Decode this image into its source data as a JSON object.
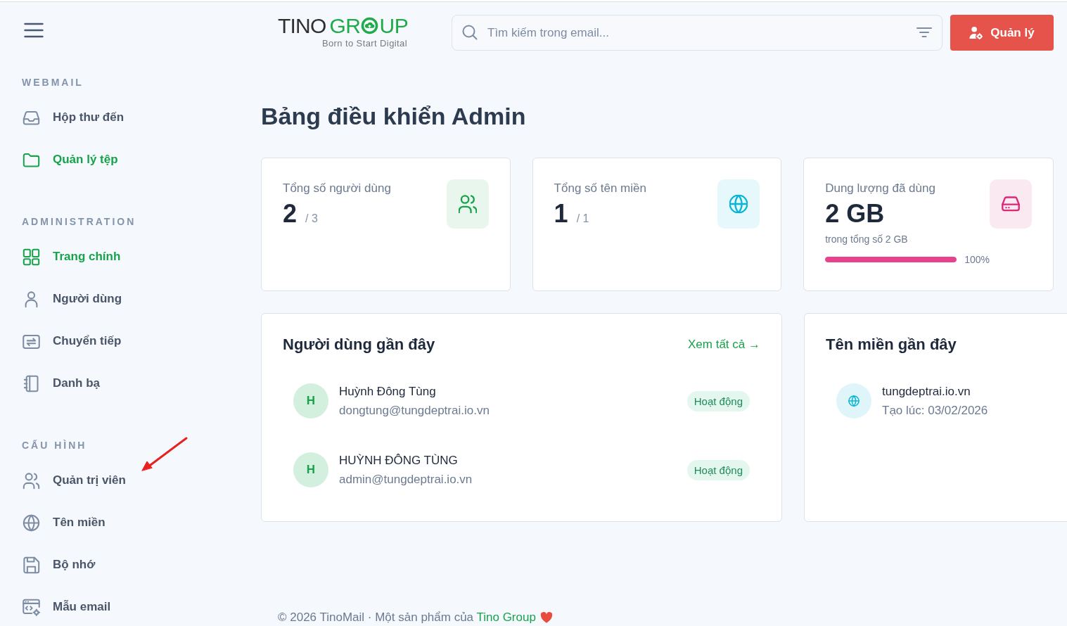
{
  "header": {
    "logo": {
      "word_parts": [
        "TINO",
        "GR",
        "UP"
      ],
      "tagline": "Born to Start Digital"
    },
    "search": {
      "placeholder": "Tìm kiếm trong email..."
    },
    "admin_button": "Quản lý"
  },
  "sidebar": {
    "sections": [
      {
        "title": "WEBMAIL",
        "items": [
          {
            "label": "Hộp thư đến",
            "selected": false
          },
          {
            "label": "Quản lý tệp",
            "selected": true
          }
        ]
      },
      {
        "title": "ADMINISTRATION",
        "items": [
          {
            "label": "Trang chính",
            "selected": true
          },
          {
            "label": "Người dùng",
            "selected": false
          },
          {
            "label": "Chuyển tiếp",
            "selected": false
          },
          {
            "label": "Danh bạ",
            "selected": false
          }
        ]
      },
      {
        "title": "CẤU HÌNH",
        "items": [
          {
            "label": "Quản trị viên",
            "selected": false
          },
          {
            "label": "Tên miền",
            "selected": false
          },
          {
            "label": "Bộ nhớ",
            "selected": false
          },
          {
            "label": "Mẫu email",
            "selected": false
          }
        ]
      }
    ]
  },
  "page_title": "Bảng điều khiển Admin",
  "stats": [
    {
      "kind": "users",
      "label": "Tổng số người dùng",
      "value": "2",
      "total": "/ 3",
      "color": "#16a34a"
    },
    {
      "kind": "domains",
      "label": "Tổng số tên miền",
      "value": "1",
      "total": "/ 1",
      "color": "#06b6d4"
    },
    {
      "kind": "storage",
      "label": "Dung lượng đã dùng",
      "value": "2 GB",
      "note": "trong tổng số 2 GB",
      "progress": {
        "level": 1.0,
        "reading": "100%"
      },
      "color": "#db2777"
    }
  ],
  "recent_users": {
    "title": "Người dùng gần đây",
    "view_all": "Xem tất cả →",
    "users": [
      {
        "initial": "H",
        "name": "Huỳnh Đông Tùng",
        "email": "dongtung@tungdeptrai.io.vn",
        "status": "Hoạt động"
      },
      {
        "initial": "H",
        "name": "HUỲNH ĐÔNG TÙNG",
        "email": "admin@tungdeptrai.io.vn",
        "status": "Hoạt động"
      }
    ]
  },
  "recent_domains": {
    "title": "Tên miền gần đây",
    "domains": [
      {
        "name": "tungdeptrai.io.vn",
        "created": "Tạo lúc: 03/02/2026"
      }
    ]
  },
  "footer": {
    "text": "© 2026 TinoMail · Một sản phẩm của",
    "link": "Tino Group"
  }
}
